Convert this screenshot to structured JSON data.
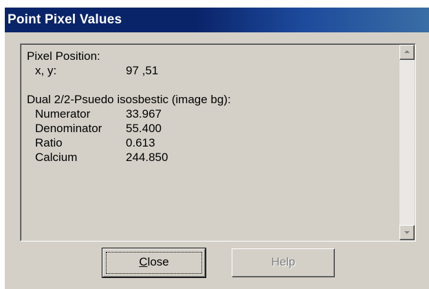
{
  "window": {
    "title": "Point Pixel Values"
  },
  "content": {
    "pixel_position_heading": "Pixel Position:",
    "xy_label": "x, y:",
    "xy_value": "97 ,51",
    "dataset_heading": "Dual 2/2-Psuedo isosbestic (image bg):",
    "values": [
      {
        "label": "Numerator",
        "value": "33.967"
      },
      {
        "label": "Denominator",
        "value": "55.400"
      },
      {
        "label": "Ratio",
        "value": "0.613"
      },
      {
        "label": "Calcium",
        "value": "244.850"
      }
    ]
  },
  "buttons": {
    "close_label": "Close",
    "help_label": "Help"
  },
  "colors": {
    "titlebar": "#0a246a",
    "face": "#d4d0c8",
    "disabled_text": "#808080"
  }
}
